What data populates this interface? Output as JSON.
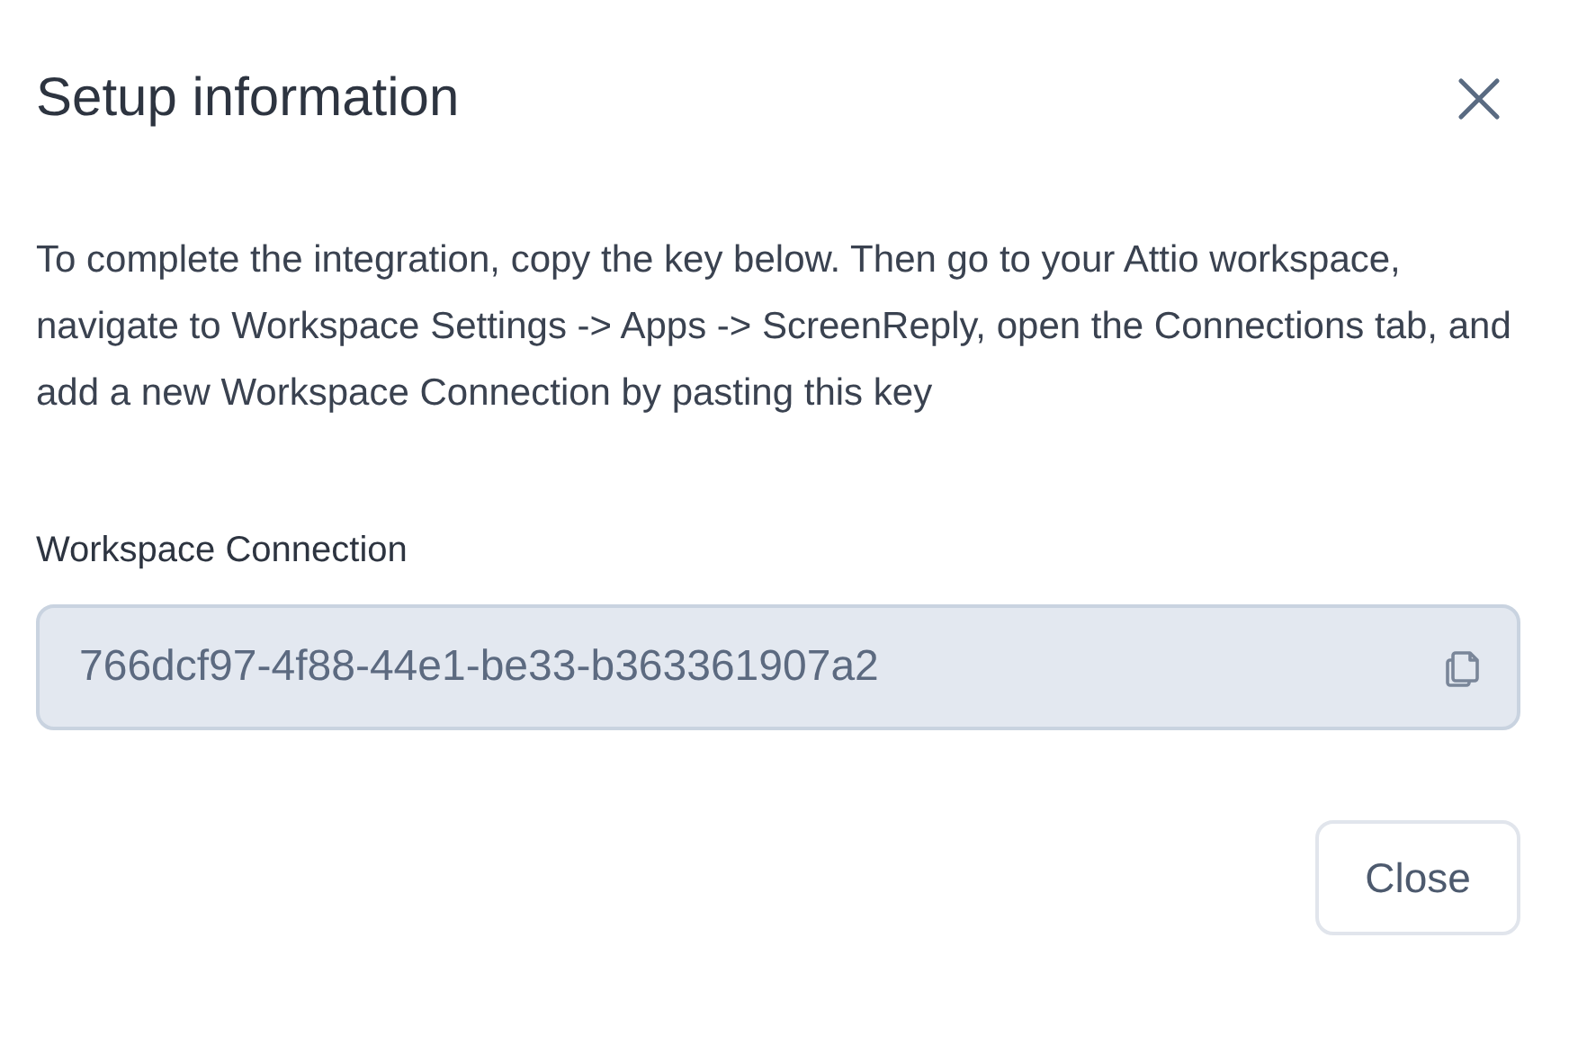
{
  "dialog": {
    "title": "Setup information",
    "description": "To complete the integration, copy the key below. Then go to your Attio workspace, navigate to Workspace Settings -> Apps -> ScreenReply, open the Connections tab, and add a new Workspace Connection by pasting this key",
    "field_label": "Workspace Connection",
    "field_value": "766dcf97-4f88-44e1-be33-b363361907a2",
    "buttons": [
      "Close"
    ]
  }
}
